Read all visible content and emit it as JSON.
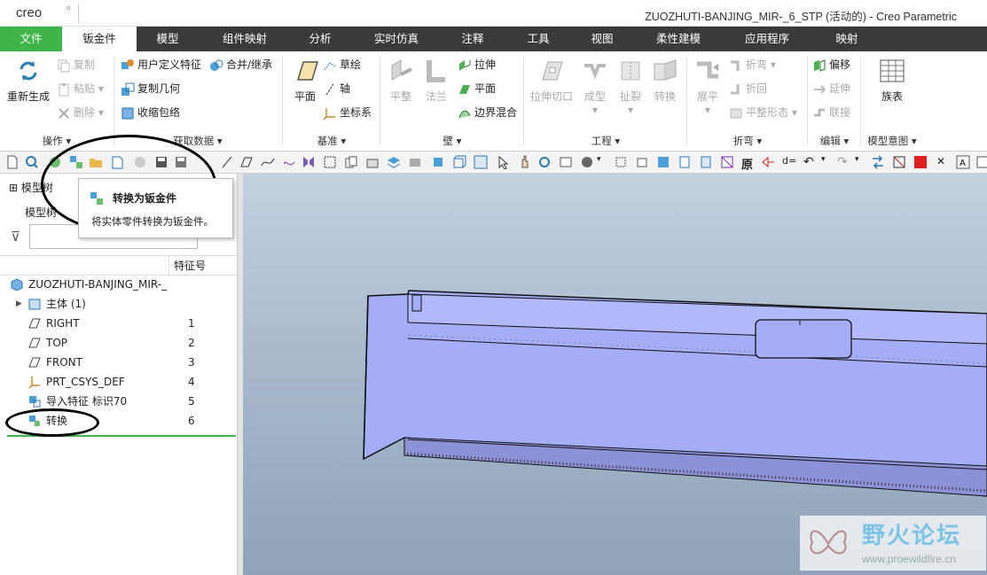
{
  "app": {
    "logo": "creo",
    "window_title": "ZUOZHUTI-BANJING_MIR-_6_STP (活动的) - Creo Parametric"
  },
  "tabs": [
    "文件",
    "钣金件",
    "模型",
    "组件映射",
    "分析",
    "实时仿真",
    "注释",
    "工具",
    "视图",
    "柔性建模",
    "应用程序",
    "映射"
  ],
  "ribbon": {
    "ops": {
      "regen": "重新生成",
      "copy": "复制",
      "paste": "粘贴",
      "delete": "删除",
      "label": "操作"
    },
    "get": {
      "udf": "用户定义特征",
      "copygeom": "复制几何",
      "shrink": "收缩包络",
      "merge": "合并/继承",
      "label": "获取数据"
    },
    "datum": {
      "plane": "平面",
      "sketch": "草绘",
      "axis": "轴",
      "csys": "坐标系",
      "label": "基准"
    },
    "wall": {
      "flat": "平整",
      "flange": "法兰",
      "extrude": "拉伸",
      "plane": "平面",
      "blend": "边界混合",
      "label": "壁"
    },
    "eng": {
      "cut": "拉伸切口",
      "form": "成型",
      "rip": "扯裂",
      "convert": "转换",
      "label": "工程"
    },
    "bend": {
      "unbend": "展平",
      "bend": "折弯",
      "bendback": "折回",
      "flatform": "平整形态",
      "label": "折弯"
    },
    "edit": {
      "offset": "偏移",
      "extend": "延伸",
      "join": "联接",
      "label": "编辑"
    },
    "table": {
      "family": "族表",
      "label": "模型意图"
    }
  },
  "tooltip": {
    "title": "转换为钣金件",
    "desc": "将实体零件转换为钣金件。"
  },
  "sidebar": {
    "tab_label": "模型树",
    "tree_heading": "模型树",
    "col_header": "特征号",
    "filter_placeholder": "",
    "items": [
      {
        "label": "ZUOZHUTI-BANJING_MIR-_",
        "num": "",
        "icon": "part-icon"
      },
      {
        "label": "主体 (1)",
        "num": "",
        "icon": "body-icon"
      },
      {
        "label": "RIGHT",
        "num": "1",
        "icon": "datum-plane-icon"
      },
      {
        "label": "TOP",
        "num": "2",
        "icon": "datum-plane-icon"
      },
      {
        "label": "FRONT",
        "num": "3",
        "icon": "datum-plane-icon"
      },
      {
        "label": "PRT_CSYS_DEF",
        "num": "4",
        "icon": "csys-icon"
      },
      {
        "label": "导入特征 标识70",
        "num": "5",
        "icon": "import-icon"
      },
      {
        "label": "转换",
        "num": "6",
        "icon": "convert-icon"
      }
    ]
  },
  "watermark": {
    "title": "野火论坛",
    "url": "www.proewildfire.cn"
  },
  "colors": {
    "accent": "#3fb449",
    "tabbar": "#3a3a3a",
    "model": "#a6adf7"
  }
}
